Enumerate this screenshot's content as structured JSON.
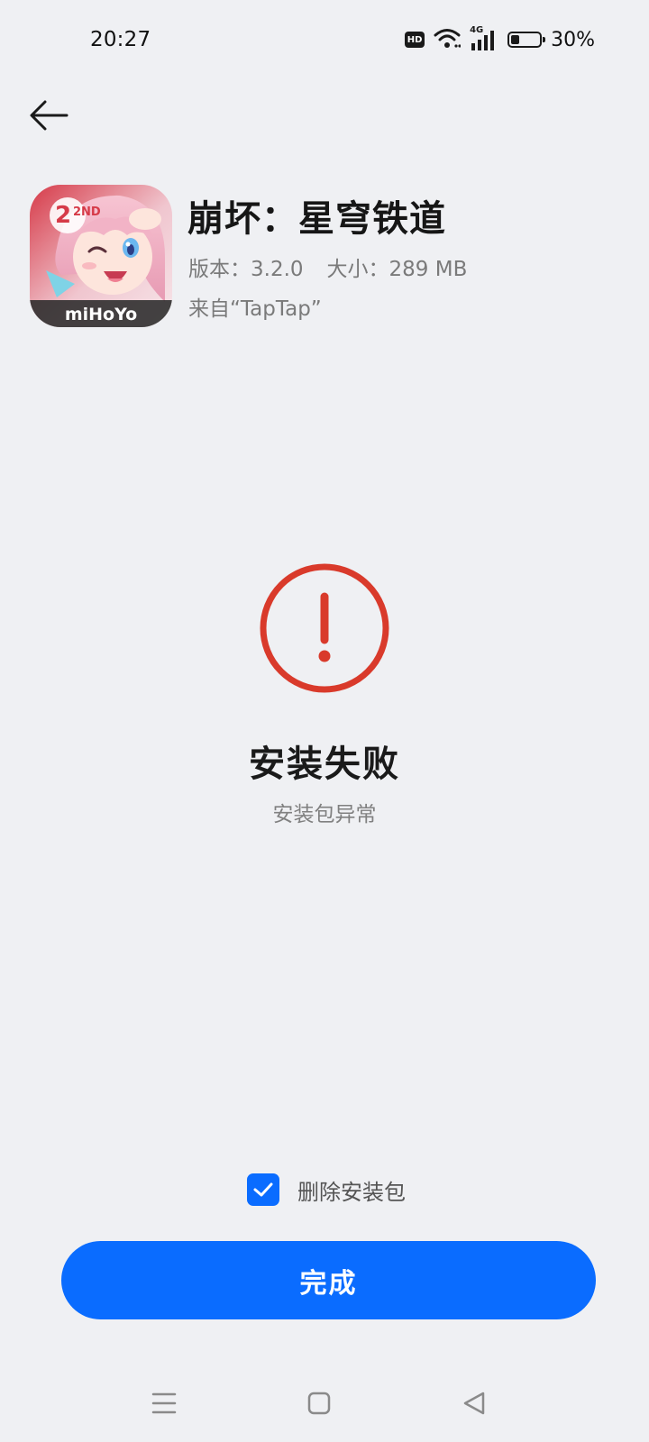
{
  "status_bar": {
    "time": "20:27",
    "hd_label": "HD",
    "network_label": "4G",
    "battery_percent": "30%",
    "battery_level": 0.3
  },
  "header": {
    "back_icon": "arrow-left-icon"
  },
  "app": {
    "name": "崩坏：星穹铁道",
    "version_text": "版本：3.2.0",
    "size_text": "大小：289 MB",
    "source_text": "来自“TapTap”",
    "icon_publisher_text": "miHoYo",
    "icon_badge_text": "2ND"
  },
  "result": {
    "icon": "exclamation-circle-icon",
    "color": "#d93a2b",
    "title": "安装失败",
    "subtitle": "安装包异常"
  },
  "options": {
    "delete_package_label": "删除安装包",
    "delete_package_checked": true
  },
  "actions": {
    "done_label": "完成",
    "accent_color": "#0a6cff"
  },
  "nav_bar": {
    "menu_icon": "menu-icon",
    "home_icon": "home-square-icon",
    "back_icon": "back-triangle-icon"
  }
}
